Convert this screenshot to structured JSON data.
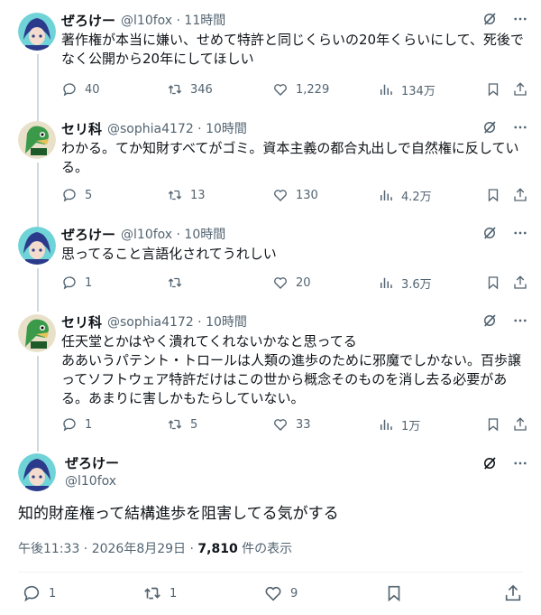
{
  "replies": [
    {
      "name": "ぜろけー",
      "meta": "@l10fox · 11時間",
      "lines": [
        "著作権が本当に嫌い、せめて特許と同じくらいの20年くらいにして、死後で",
        "なく公開から20年にしてほしい"
      ],
      "replies": "40",
      "retweets": "346",
      "likes": "1,229",
      "views": "134万"
    },
    {
      "name": "セリ科",
      "meta": "@sophia4172 · 10時間",
      "lines": [
        "わかる。てか知財すべてがゴミ。資本主義の都合丸出しで自然権に反してい",
        "る。"
      ],
      "replies": "5",
      "retweets": "13",
      "likes": "130",
      "views": "4.2万"
    },
    {
      "name": "ぜろけー",
      "meta": "@l10fox · 10時間",
      "lines": [
        "思ってること言語化されてうれしい"
      ],
      "replies": "1",
      "retweets": "",
      "likes": "20",
      "views": "3.6万"
    },
    {
      "name": "セリ科",
      "meta": "@sophia4172 · 10時間",
      "lines": [
        "任天堂とかはやく潰れてくれないかなと思ってる",
        "ああいうパテント・トロールは人類の進歩のために邪魔でしかない。百歩譲",
        "ってソフトウェア特許だけはこの世から概念そのものを消し去る必要があ",
        "る。あまりに害しかもたらしていない。"
      ],
      "replies": "1",
      "retweets": "5",
      "likes": "33",
      "views": "1万"
    }
  ],
  "main": {
    "name": "ぜろけー",
    "handle": "@l10fox",
    "text": "知的財産権って結構進歩を阻害してる気がする",
    "time": "午後11:33 · 2026年8月29日 · ",
    "views_count": "7,810",
    "views_label": " 件の表示",
    "replies": "1",
    "retweets": "1",
    "likes": "9"
  },
  "icons": {
    "reply": "reply-icon",
    "retweet": "retweet-icon",
    "like": "heart-icon",
    "views": "views-icon",
    "bookmark": "bookmark-icon",
    "share": "share-icon",
    "grok": "grok-icon",
    "more": "more-icon"
  }
}
